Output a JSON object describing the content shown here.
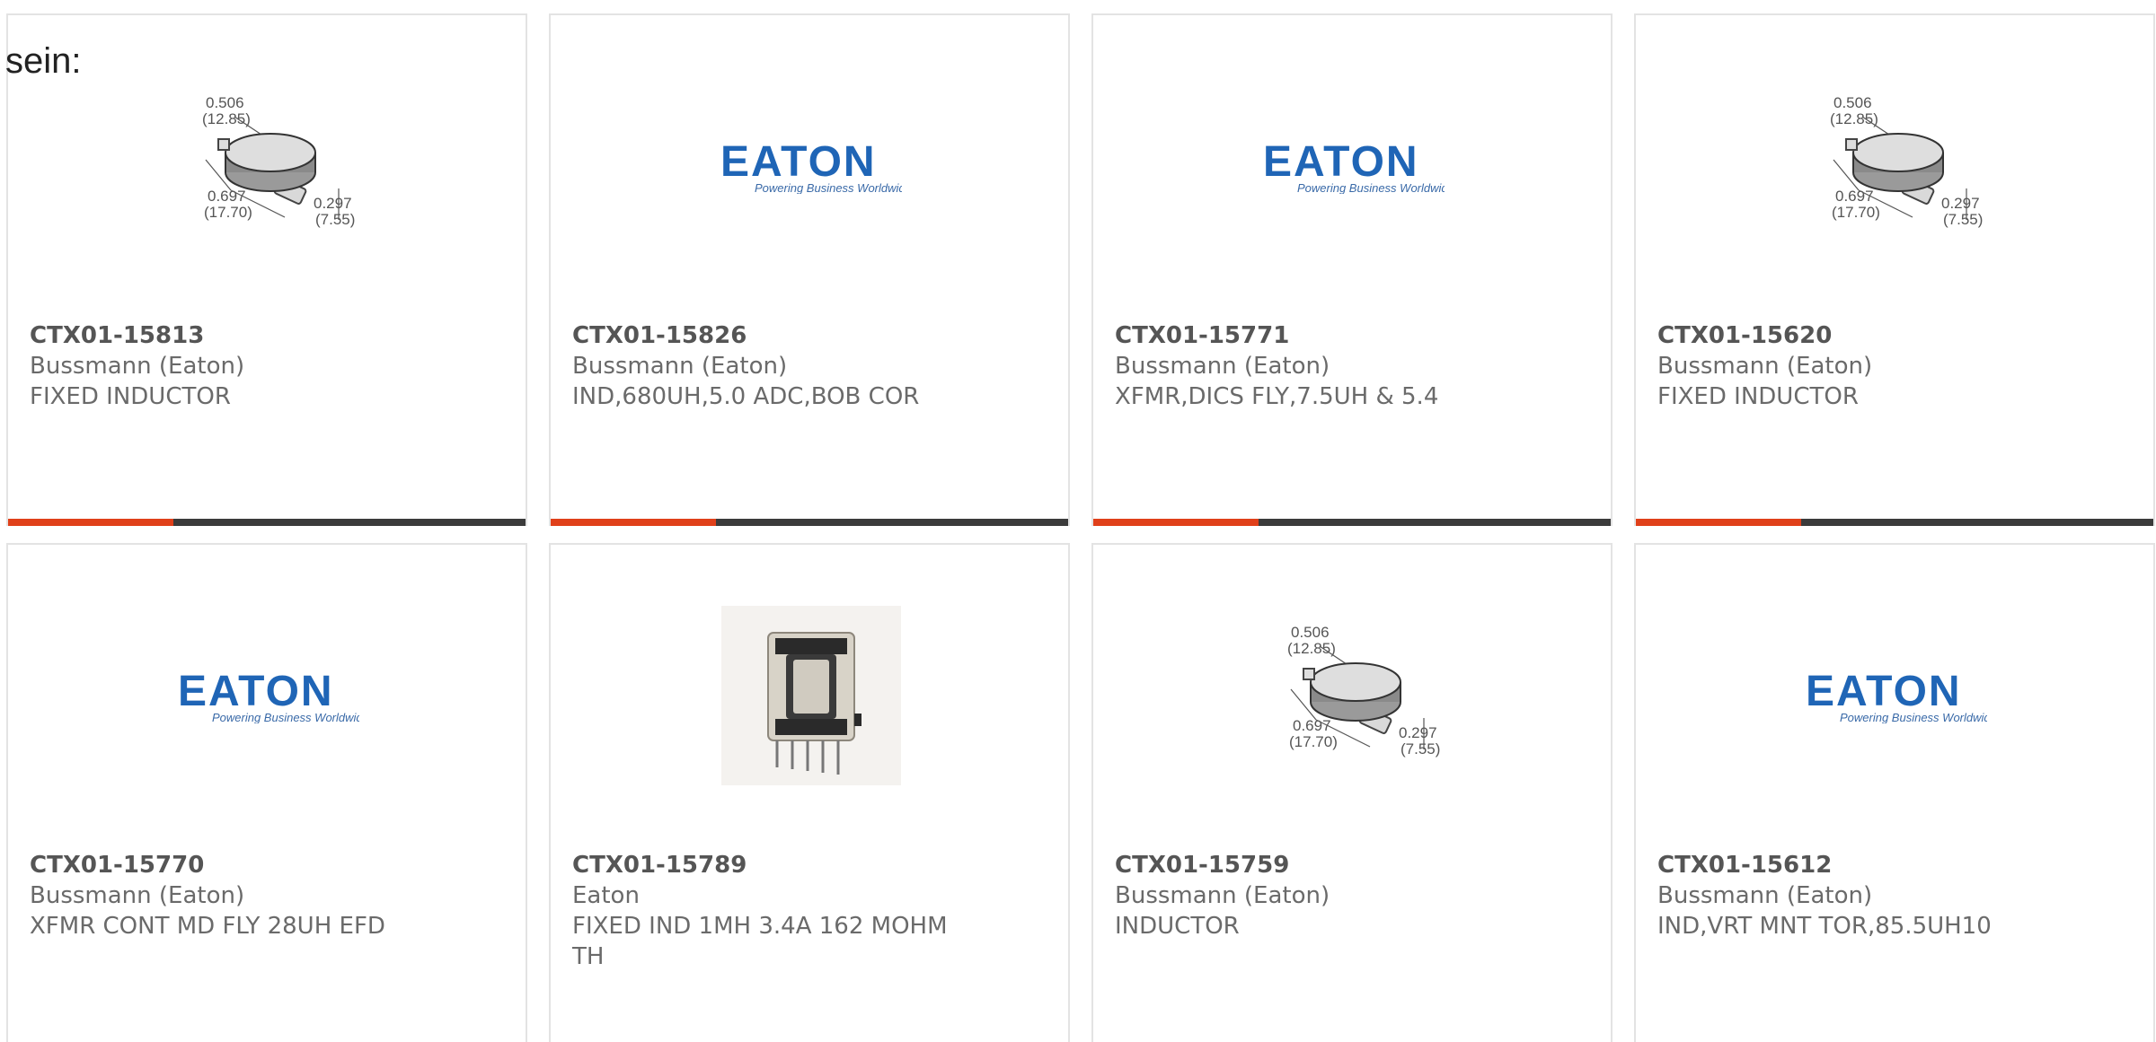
{
  "lead_text": "sein:",
  "colors": {
    "accent": "#e0401a",
    "bar": "#3b3b3b",
    "eaton_blue": "#1f65b6",
    "card_border": "#e3e3e3"
  },
  "products": [
    {
      "part_number": "CTX01-15813",
      "manufacturer": "Bussmann (Eaton)",
      "description": "FIXED INDUCTOR",
      "image": "inductor-dimension-drawing",
      "dims": {
        "d1": "0.506",
        "d1mm": "(12.85)",
        "d2": "0.697",
        "d2mm": "(17.70)",
        "d3": "0.297",
        "d3mm": "(7.55)"
      }
    },
    {
      "part_number": "CTX01-15826",
      "manufacturer": "Bussmann (Eaton)",
      "description": "IND,680UH,5.0 ADC,BOB COR",
      "image": "eaton-logo",
      "logo": {
        "word": "EATON",
        "tagline": "Powering Business Worldwide"
      }
    },
    {
      "part_number": "CTX01-15771",
      "manufacturer": "Bussmann (Eaton)",
      "description": "XFMR,DICS FLY,7.5UH & 5.4",
      "image": "eaton-logo",
      "logo": {
        "word": "EATON",
        "tagline": "Powering Business Worldwide"
      }
    },
    {
      "part_number": "CTX01-15620",
      "manufacturer": "Bussmann (Eaton)",
      "description": "FIXED INDUCTOR",
      "image": "inductor-dimension-drawing",
      "dims": {
        "d1": "0.506",
        "d1mm": "(12.85)",
        "d2": "0.697",
        "d2mm": "(17.70)",
        "d3": "0.297",
        "d3mm": "(7.55)"
      }
    },
    {
      "part_number": "CTX01-15770",
      "manufacturer": "Bussmann (Eaton)",
      "description": "XFMR CONT MD FLY 28UH EFD",
      "image": "eaton-logo",
      "logo": {
        "word": "EATON",
        "tagline": "Powering Business Worldwide"
      }
    },
    {
      "part_number": "CTX01-15789",
      "manufacturer": "Eaton",
      "description": "FIXED IND 1MH 3.4A 162 MOHM TH",
      "image": "transformer-photo"
    },
    {
      "part_number": "CTX01-15759",
      "manufacturer": "Bussmann (Eaton)",
      "description": "INDUCTOR",
      "image": "inductor-dimension-drawing",
      "dims": {
        "d1": "0.506",
        "d1mm": "(12.85)",
        "d2": "0.697",
        "d2mm": "(17.70)",
        "d3": "0.297",
        "d3mm": "(7.55)"
      }
    },
    {
      "part_number": "CTX01-15612",
      "manufacturer": "Bussmann (Eaton)",
      "description": "IND,VRT MNT TOR,85.5UH10",
      "image": "eaton-logo",
      "logo": {
        "word": "EATON",
        "tagline": "Powering Business Worldwide"
      }
    }
  ]
}
